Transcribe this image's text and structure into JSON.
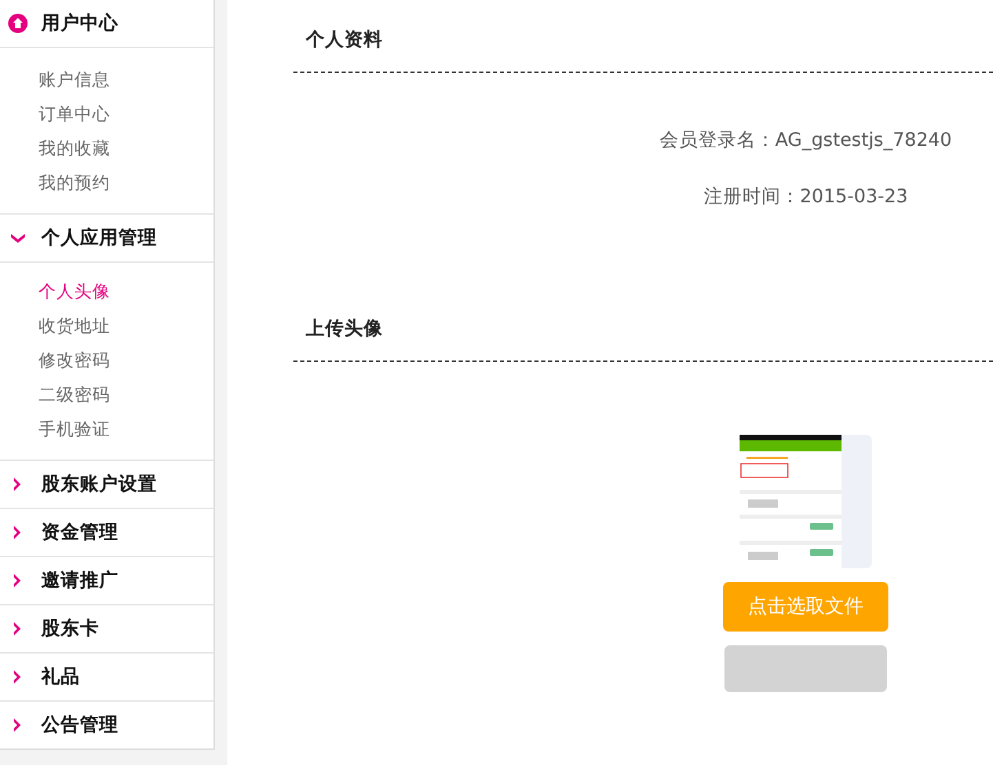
{
  "sidebar": {
    "groups": [
      {
        "label": "用户中心",
        "kind": "home",
        "items": [
          {
            "label": "账户信息",
            "selected": false
          },
          {
            "label": "订单中心",
            "selected": false
          },
          {
            "label": "我的收藏",
            "selected": false
          },
          {
            "label": "我的预约",
            "selected": false
          }
        ]
      },
      {
        "label": "个人应用管理",
        "kind": "toggle",
        "expanded": true,
        "items": [
          {
            "label": "个人头像",
            "selected": true
          },
          {
            "label": "收货地址",
            "selected": false
          },
          {
            "label": "修改密码",
            "selected": false
          },
          {
            "label": "二级密码",
            "selected": false
          },
          {
            "label": "手机验证",
            "selected": false
          }
        ]
      },
      {
        "label": "股东账户设置",
        "kind": "toggle",
        "expanded": false
      },
      {
        "label": "资金管理",
        "kind": "toggle",
        "expanded": false
      },
      {
        "label": "邀请推广",
        "kind": "toggle",
        "expanded": false
      },
      {
        "label": "股东卡",
        "kind": "toggle",
        "expanded": false
      },
      {
        "label": "礼品",
        "kind": "toggle",
        "expanded": false
      },
      {
        "label": "公告管理",
        "kind": "toggle",
        "expanded": false
      }
    ]
  },
  "profile": {
    "title": "个人资料",
    "lines": [
      "会员登录名：AG_gstestjs_78240",
      "注册时间：2015-03-23"
    ]
  },
  "upload": {
    "title": "上传头像",
    "choose_button": "点击选取文件",
    "upload_button": {
      "disabled": true
    }
  }
}
